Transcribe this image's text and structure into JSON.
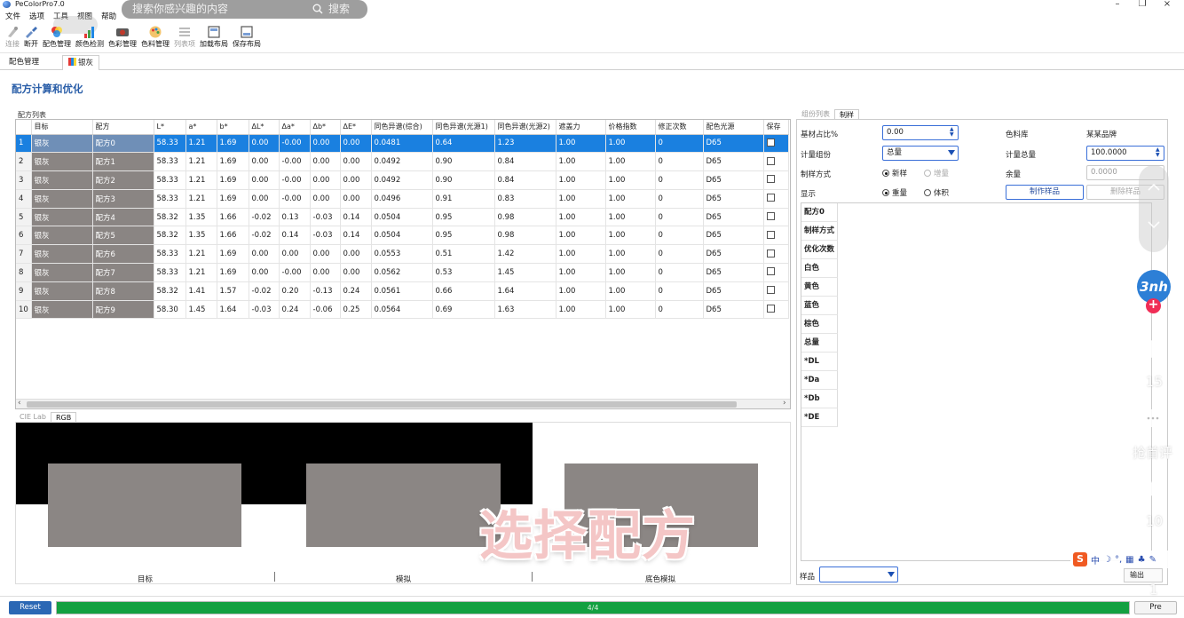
{
  "window": {
    "title": "PeColorPro7.0",
    "minimize": "–",
    "maximize": "❐",
    "close": "×"
  },
  "menu": [
    "文件",
    "选项",
    "工具",
    "视图",
    "帮助"
  ],
  "search_overlay": {
    "placeholder": "搜索你感兴趣的内容",
    "button": "搜索"
  },
  "toolbar": [
    {
      "label": "连接",
      "icon": "connect-icon",
      "disabled": true
    },
    {
      "label": "断开",
      "icon": "disconnect-icon",
      "disabled": false
    },
    {
      "label": "配色管理",
      "icon": "color-match-icon",
      "disabled": false
    },
    {
      "label": "颜色检测",
      "icon": "color-detect-icon",
      "disabled": false
    },
    {
      "label": "色彩管理",
      "icon": "color-manage-icon",
      "disabled": false
    },
    {
      "label": "色料管理",
      "icon": "colorant-manage-icon",
      "disabled": false
    },
    {
      "label": "列表项",
      "icon": "list-items-icon",
      "disabled": true
    },
    {
      "label": "加载布局",
      "icon": "load-layout-icon",
      "disabled": false
    },
    {
      "label": "保存布局",
      "icon": "save-layout-icon",
      "disabled": false
    }
  ],
  "doc_tabs": {
    "first": "配色管理",
    "second": "银灰"
  },
  "page_heading": "配方计算和优化",
  "formula_list": {
    "caption": "配方列表",
    "columns": [
      "",
      "目标",
      "配方",
      "L*",
      "a*",
      "b*",
      "ΔL*",
      "Δa*",
      "Δb*",
      "ΔE*",
      "同色异谱(综合)",
      "同色异谱(光源1)",
      "同色异谱(光源2)",
      "遮盖力",
      "价格指数",
      "修正次数",
      "配色光源",
      "保存"
    ],
    "selected_index": 0,
    "rows": [
      [
        "1",
        "银灰",
        "配方0",
        "58.33",
        "1.21",
        "1.69",
        "0.00",
        "-0.00",
        "0.00",
        "0.00",
        "0.0481",
        "0.64",
        "1.23",
        "1.00",
        "1.00",
        "0",
        "D65"
      ],
      [
        "2",
        "银灰",
        "配方1",
        "58.33",
        "1.21",
        "1.69",
        "0.00",
        "-0.00",
        "0.00",
        "0.00",
        "0.0492",
        "0.90",
        "0.84",
        "1.00",
        "1.00",
        "0",
        "D65"
      ],
      [
        "3",
        "银灰",
        "配方2",
        "58.33",
        "1.21",
        "1.69",
        "0.00",
        "-0.00",
        "0.00",
        "0.00",
        "0.0492",
        "0.90",
        "0.84",
        "1.00",
        "1.00",
        "0",
        "D65"
      ],
      [
        "4",
        "银灰",
        "配方3",
        "58.33",
        "1.21",
        "1.69",
        "0.00",
        "-0.00",
        "0.00",
        "0.00",
        "0.0496",
        "0.91",
        "0.83",
        "1.00",
        "1.00",
        "0",
        "D65"
      ],
      [
        "5",
        "银灰",
        "配方4",
        "58.32",
        "1.35",
        "1.66",
        "-0.02",
        "0.13",
        "-0.03",
        "0.14",
        "0.0504",
        "0.95",
        "0.98",
        "1.00",
        "1.00",
        "0",
        "D65"
      ],
      [
        "6",
        "银灰",
        "配方5",
        "58.32",
        "1.35",
        "1.66",
        "-0.02",
        "0.14",
        "-0.03",
        "0.14",
        "0.0504",
        "0.95",
        "0.98",
        "1.00",
        "1.00",
        "0",
        "D65"
      ],
      [
        "7",
        "银灰",
        "配方6",
        "58.33",
        "1.21",
        "1.69",
        "0.00",
        "0.00",
        "0.00",
        "0.00",
        "0.0553",
        "0.51",
        "1.42",
        "1.00",
        "1.00",
        "0",
        "D65"
      ],
      [
        "8",
        "银灰",
        "配方7",
        "58.33",
        "1.21",
        "1.69",
        "0.00",
        "-0.00",
        "0.00",
        "0.00",
        "0.0562",
        "0.53",
        "1.45",
        "1.00",
        "1.00",
        "0",
        "D65"
      ],
      [
        "9",
        "银灰",
        "配方8",
        "58.32",
        "1.41",
        "1.57",
        "-0.02",
        "0.20",
        "-0.13",
        "0.24",
        "0.0561",
        "0.66",
        "1.64",
        "1.00",
        "1.00",
        "0",
        "D65"
      ],
      [
        "10",
        "银灰",
        "配方9",
        "58.30",
        "1.45",
        "1.64",
        "-0.03",
        "0.24",
        "-0.06",
        "0.25",
        "0.0564",
        "0.69",
        "1.63",
        "1.00",
        "1.00",
        "0",
        "D65"
      ]
    ],
    "scroll_left": "‹",
    "scroll_right": "›"
  },
  "preview": {
    "tabs": [
      "CIE Lab",
      "RGB"
    ],
    "active_tab": "RGB",
    "panes": [
      "目标",
      "模拟",
      "底色模拟"
    ],
    "swatch_color": "#8b8684"
  },
  "overlay_caption": "选择配方",
  "right_panel": {
    "tabs": [
      "组份列表",
      "制样"
    ],
    "active_tab": "制样",
    "base_ratio_label": "基材占比%",
    "base_ratio_value": "0.00",
    "measure_component_label": "计量组份",
    "measure_component_value": "总量",
    "method_label": "制样方式",
    "method_options": [
      "新样",
      "增量"
    ],
    "display_label": "显示",
    "display_options": [
      "重量",
      "体积"
    ],
    "colorant_lib_label": "色料库",
    "colorant_lib_value": "某某品牌",
    "total_label": "计量总量",
    "total_value": "100.0000",
    "remain_label": "余量",
    "remain_value": "0.0000",
    "make_sample_button": "制作样品",
    "delete_sample_button": "删除样品",
    "result_rows": [
      "配方0",
      "制样方式",
      "优化次数",
      "白色",
      "黄色",
      "蓝色",
      "棕色",
      "总量",
      "*DL",
      "*Da",
      "*Db",
      "*DE"
    ],
    "sample_label": "样品",
    "export_button": "输出"
  },
  "bottom": {
    "reset": "Reset",
    "progress_text": "4/4",
    "progress_fraction": 1.0,
    "pre": "Pre"
  },
  "video_overlay": {
    "avatar_text": "3nh",
    "follow": "+",
    "like_count": "15",
    "comment_label": "抢首评",
    "favorite_count": "10",
    "share_count": "1",
    "ime_text": "中"
  },
  "colors": {
    "accent": "#2a5ea8",
    "selection": "#1a80e0",
    "swatch": "#8a8583",
    "progress": "#13a041",
    "reset_button": "#2b67b4"
  }
}
